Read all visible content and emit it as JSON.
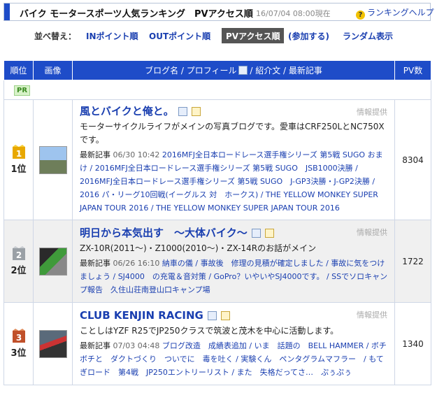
{
  "header": {
    "title": "バイク モータースポーツ人気ランキング　PVアクセス順",
    "timestamp": "16/07/04 08:00現在",
    "help_label": "ランキングヘルプ",
    "help_icon": "question-icon"
  },
  "sort": {
    "label": "並べ替え：",
    "in_points": "INポイント順",
    "out_points": "OUTポイント順",
    "pv_access": "PVアクセス順",
    "join": "(参加する)",
    "random": "ランダム表示"
  },
  "table": {
    "headers": {
      "rank": "順位",
      "image": "画像",
      "blog": "ブログ名 / プロフィール",
      "blog_rest": " / 紹介文 / 最新記事",
      "pv": "PV数"
    },
    "pr": "PR",
    "info_label": "情報提供",
    "latest_label": "最新記事",
    "rows": [
      {
        "rank_label": "1位",
        "rank_num": "1",
        "blog_title": "風とバイクと俺と。",
        "intro": "モーターサイクルライフがメインの写真ブログです。愛車はCRF250LとNC750Xです。",
        "latest_time": "06/30 10:42",
        "latest_text": "2016MFJ全日本ロードレース選手権シリーズ 第5戦 SUGO おまけ / 2016MFJ全日本ロードレース選手権シリーズ 第5戦 SUGO　JSB1000決勝 / 2016MFJ全日本ロードレース選手権シリーズ 第5戦 SUGO　J-GP3決勝・J-GP2決勝 / 2016 パ・リーグ10回戦(イーグルス 対　ホークス) / THE YELLOW MONKEY SUPER JAPAN TOUR 2016 / THE YELLOW MONKEY SUPER JAPAN TOUR 2016",
        "pv": "8304"
      },
      {
        "rank_label": "2位",
        "rank_num": "2",
        "blog_title": "明日から本気出す　～大体バイク～",
        "intro": "ZX-10R(2011～)・Z1000(2010～)・ZX-14Rのお話がメイン",
        "latest_time": "06/26 16:10",
        "latest_text": "納車の儀 / 事故後　修理の見積が確定しました / 事故に気をつけましょう / SJ4000　の充電＆音対策 / GoPro？いやいやSJ4000です。 / SSでソロキャンプ報告　久住山荘南登山口キャンプ場",
        "pv": "1722"
      },
      {
        "rank_label": "3位",
        "rank_num": "3",
        "blog_title": "CLUB KENJIN RACING",
        "intro": "ことしはYZF R25でJP250クラスで筑波と茂木を中心に活動します。",
        "latest_time": "07/03 04:48",
        "latest_text": "ブログ改造　成績表追加 / いま　話題の　BELL HAMMER / ボチボチと　ダクトづくり　ついでに　毒を吐く / 実験くん　ペンタグラムマフラー　/ もてぎロード　第4戦　JP250エントリーリスト / また　失格だってさ…　ぷぅぷぅ",
        "pv": "1340"
      }
    ]
  },
  "colors": {
    "accent": "#1e4cc8",
    "link": "#1a3fb0",
    "gold": "#e8a800",
    "silver": "#9aa0a6",
    "bronze": "#c0502a"
  }
}
